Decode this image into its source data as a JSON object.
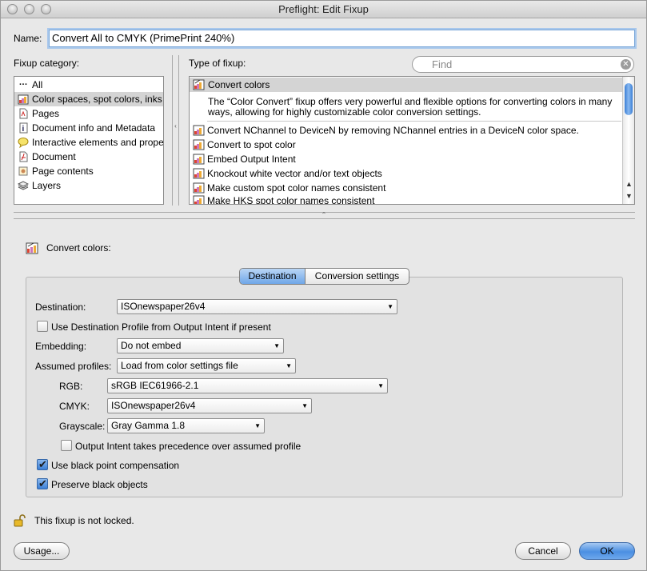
{
  "window": {
    "title": "Preflight: Edit Fixup"
  },
  "name_field": {
    "label": "Name:",
    "value": "Convert All to CMYK (PrimePrint 240%)"
  },
  "fixup_category": {
    "label": "Fixup category:",
    "items": [
      {
        "label": "All",
        "icon": "ellipsis-icon"
      },
      {
        "label": "Color spaces, spot colors, inks",
        "icon": "color-spaces-icon",
        "selected": true
      },
      {
        "label": "Pages",
        "icon": "page-icon"
      },
      {
        "label": "Document info and Metadata",
        "icon": "info-icon"
      },
      {
        "label": "Interactive elements and prope",
        "icon": "comment-icon"
      },
      {
        "label": "Document",
        "icon": "pdf-icon"
      },
      {
        "label": "Page contents",
        "icon": "page-contents-icon"
      },
      {
        "label": "Layers",
        "icon": "layers-icon"
      }
    ]
  },
  "type_of_fixup": {
    "label": "Type of fixup:",
    "search_placeholder": "Find",
    "selected_label": "Convert colors",
    "selected_description": "The “Color Convert” fixup offers very powerful and flexible options for converting colors in many ways, allowing for highly customizable color conversion settings.",
    "items": [
      "Convert NChannel to DeviceN by removing NChannel entries in a DeviceN color space.",
      "Convert to spot color",
      "Embed Output Intent",
      "Knockout white vector and/or text objects",
      "Make custom spot color names consistent",
      "Make HKS spot color names consistent"
    ]
  },
  "detail": {
    "heading": "Convert colors:",
    "tabs": [
      "Destination",
      "Conversion settings"
    ],
    "active_tab": "Destination",
    "destination": {
      "label": "Destination:",
      "value": "ISOnewspaper26v4"
    },
    "use_output_intent": {
      "label": "Use Destination Profile from Output Intent if present",
      "checked": false
    },
    "embedding": {
      "label": "Embedding:",
      "value": "Do not embed"
    },
    "assumed_profiles": {
      "label": "Assumed profiles:",
      "value": "Load from color settings file"
    },
    "rgb": {
      "label": "RGB:",
      "value": "sRGB IEC61966-2.1"
    },
    "cmyk": {
      "label": "CMYK:",
      "value": "ISOnewspaper26v4"
    },
    "grayscale": {
      "label": "Grayscale:",
      "value": "Gray Gamma 1.8"
    },
    "output_intent_precedence": {
      "label": "Output Intent takes precedence over assumed profile",
      "checked": false
    },
    "black_point": {
      "label": "Use black point compensation",
      "checked": true
    },
    "preserve_black": {
      "label": "Preserve black objects",
      "checked": true
    }
  },
  "lock_status": "This fixup is not locked.",
  "buttons": {
    "usage": "Usage...",
    "cancel": "Cancel",
    "ok": "OK"
  },
  "colors": {
    "accent": "#3b7fd6",
    "selection": "#d4d4d4"
  }
}
